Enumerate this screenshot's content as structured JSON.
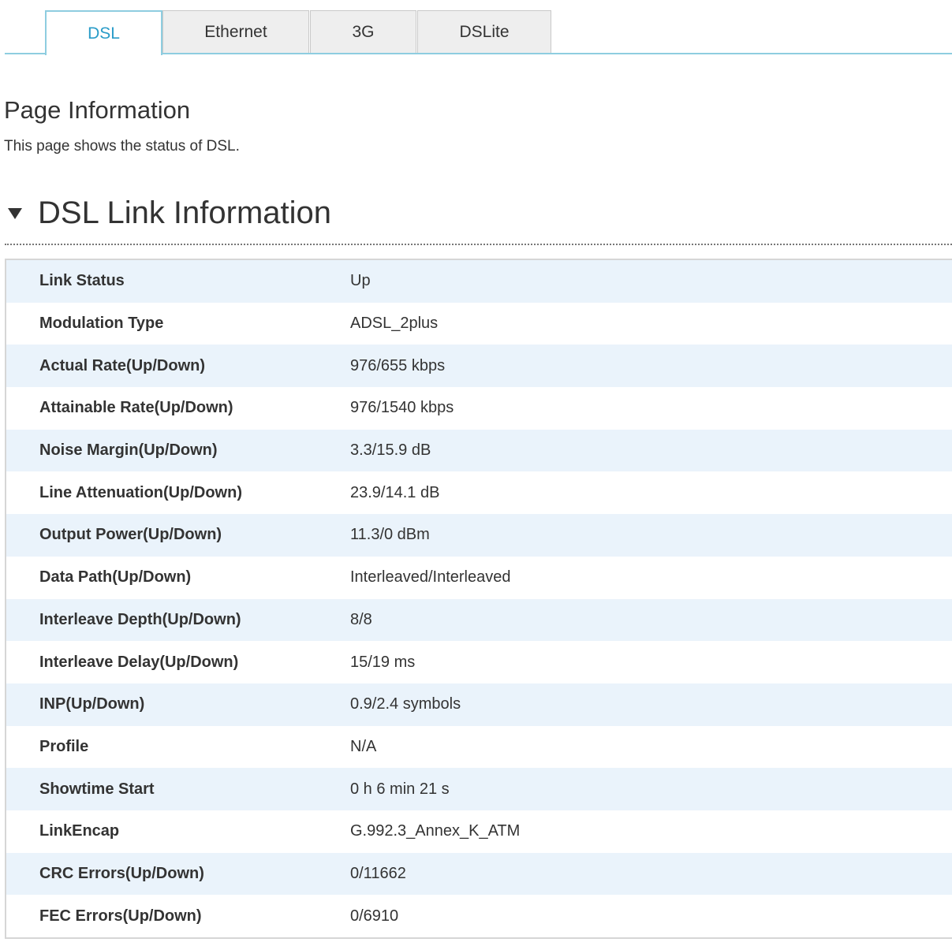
{
  "tabs": [
    {
      "label": "DSL",
      "active": true
    },
    {
      "label": "Ethernet",
      "active": false
    },
    {
      "label": "3G",
      "active": false
    },
    {
      "label": "DSLite",
      "active": false
    }
  ],
  "page_info": {
    "title": "Page Information",
    "description": "This page shows the status of DSL."
  },
  "section": {
    "title": "DSL Link Information",
    "toggle_icon": "triangle-down-icon",
    "rows": [
      {
        "label": "Link Status",
        "value": "Up"
      },
      {
        "label": "Modulation Type",
        "value": "ADSL_2plus"
      },
      {
        "label": "Actual Rate(Up/Down)",
        "value": "976/655 kbps"
      },
      {
        "label": "Attainable Rate(Up/Down)",
        "value": "976/1540 kbps"
      },
      {
        "label": "Noise Margin(Up/Down)",
        "value": "3.3/15.9 dB"
      },
      {
        "label": "Line Attenuation(Up/Down)",
        "value": "23.9/14.1 dB"
      },
      {
        "label": "Output Power(Up/Down)",
        "value": "11.3/0 dBm"
      },
      {
        "label": "Data Path(Up/Down)",
        "value": "Interleaved/Interleaved"
      },
      {
        "label": "Interleave Depth(Up/Down)",
        "value": "8/8"
      },
      {
        "label": "Interleave Delay(Up/Down)",
        "value": "15/19 ms"
      },
      {
        "label": "INP(Up/Down)",
        "value": "0.9/2.4 symbols"
      },
      {
        "label": "Profile",
        "value": "N/A"
      },
      {
        "label": "Showtime Start",
        "value": "0 h 6 min 21 s"
      },
      {
        "label": "LinkEncap",
        "value": "G.992.3_Annex_K_ATM"
      },
      {
        "label": "CRC Errors(Up/Down)",
        "value": "0/11662"
      },
      {
        "label": "FEC Errors(Up/Down)",
        "value": "0/6910"
      }
    ]
  },
  "colors": {
    "accent": "#2a9cc8",
    "tab_line": "#8ecde0",
    "row_stripe": "#eaf3fb"
  }
}
